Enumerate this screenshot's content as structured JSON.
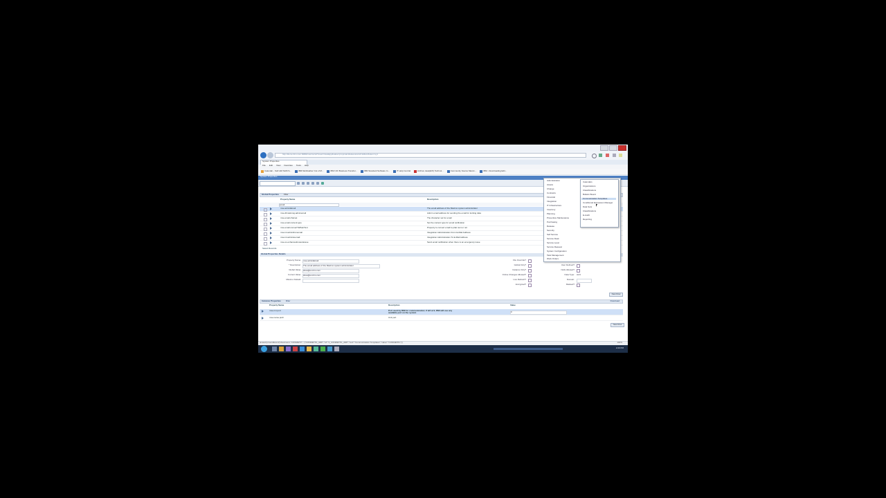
{
  "browser": {
    "address": "http://demo.ibm.com:9080/maximo/ui/?event=loadapp&value=propmaint&uisessionid=12&csrftoken=xyz",
    "tab_label": "System Properties",
    "menu": [
      "File",
      "Edit",
      "View",
      "Favorites",
      "Tools",
      "Help"
    ],
    "favorites": [
      "Calendar - SoP-AM NAM S...",
      "IBM MultiGather Out of M...",
      "IBM CIO Business Transfor...",
      "IBM Standard Software In...",
      "IT Help Central",
      "Archive Java(EXI) Technol...",
      "Community Source Maxim...",
      "IBM - Downloading Edit..."
    ]
  },
  "app": {
    "title": "System Properties",
    "global_properties_label": "Global Properties",
    "filter_label": "Filter",
    "columns": {
      "name": "Property Name",
      "description": "Description"
    },
    "filter_value": "email",
    "rows": [
      {
        "name": "mxe.adminEmail",
        "description": "The email address of the Maximo system administrator",
        "selected": true
      },
      {
        "name": "mxe.db.lastmsg.adminemail",
        "description": "Admin email address for sending the email for locking data"
      },
      {
        "name": "mxe.email.charset",
        "description": "The character set for email"
      },
      {
        "name": "mxe.email.content.type",
        "description": "Set the content type for email notification"
      },
      {
        "name": "mxe.email.convertToPlainText",
        "description": "Property to convert email to plain text or not"
      },
      {
        "name": "mxe.int.adminfromemail",
        "description": "Integration Administration From E-Mail Address"
      },
      {
        "name": "mxe.int.admintoemail",
        "description": "Integration Administration To E-Mail Address"
      },
      {
        "name": "mxe.os.enhancedmxautoissue",
        "description": "Send email notification when there is an emergency issue"
      }
    ],
    "select_records": "Select Records",
    "details_section": "Global Properties Details",
    "details": {
      "property_name": {
        "label": "Property Name:",
        "value": "mxe.adminEmail"
      },
      "description": {
        "label": "* Description:",
        "value": "The email address of the Maximo system administrator"
      },
      "global_value": {
        "label": "Global Value:",
        "value": "sbao@us.ibm.com"
      },
      "current_value": {
        "label": "Current Value:",
        "value": "sbao@us.ibm.com"
      },
      "maximo_default": {
        "label": "Maximo Default:",
        "value": ""
      }
    },
    "flags": [
      "File Override?",
      "Global Only?",
      "Instance Only?",
      "Online Changes Allowed?",
      "Live Refresh?",
      "Encrypted?"
    ],
    "flags_right": [
      "Security Level:",
      "User Defined?",
      "Nulls Allowed?",
      "Data Type:",
      "Domain:",
      "Masked?"
    ],
    "security_level_value": "SECURE",
    "data_type_value": "ALN",
    "instance_section": "Instance Properties",
    "instance_columns": {
      "name": "Property Name",
      "description": "Description",
      "value": "Value"
    },
    "instance_rows": [
      {
        "name": "mxe.rmi.port",
        "description": "Port used by RMI for communication; if left at 0, RMI will use any available port on the system",
        "value": "0"
      },
      {
        "name": "mxe.name.prefi",
        "description": "Unit port",
        "value": ""
      }
    ],
    "new_row": "New Row",
    "download": "Download"
  },
  "menu_dropdown": {
    "items": [
      "Administration",
      "Assets",
      "Change",
      "Contracts",
      "Financial",
      "Integration",
      "IT Infrastructure",
      "Inventory",
      "Planning",
      "Preventive Maintenance",
      "Purchasing",
      "Release",
      "Security",
      "Self Service",
      "Service Desk",
      "Service Level",
      "Service Request",
      "System Configuration",
      "Task Management",
      "Work Orders"
    ],
    "submenu": [
      "Calendars",
      "Organizations",
      "Classifications",
      "Bulletin Board",
      "Communication Templates",
      "Conditional Expression Manager",
      "Data Sets",
      "Classifications",
      "E-Audit",
      "Reporting"
    ],
    "highlighted": "Communication Templates"
  },
  "status": {
    "text": "javascript:sendEvent('showmenu','CONMETP','','{\"CONMETPL_ARP\",\"id\":\"1_CONMETPL_ARP\",\"text\":\"Communication Templates\",\"value\":\"CONMETPL\"}')",
    "zoom": "100%"
  },
  "taskbar": {
    "clock": "2:20 PM"
  }
}
